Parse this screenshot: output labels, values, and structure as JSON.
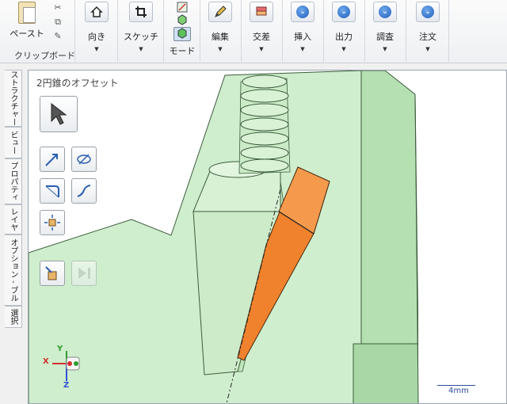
{
  "ribbon": {
    "paste_label": "ペースト",
    "clipboard_group_label": "クリップボード",
    "buttons": [
      {
        "label": "向き",
        "icon": "home-icon"
      },
      {
        "label": "スケッチ",
        "icon": "crop-sketch-icon"
      },
      {
        "label": "モード",
        "icon": "mode-solid-icon"
      },
      {
        "label": "編集",
        "icon": "pencil-edit-icon"
      },
      {
        "label": "交差",
        "icon": "intersect-icon"
      },
      {
        "label": "挿入",
        "icon": "circle-arrow-icon"
      },
      {
        "label": "出力",
        "icon": "circle-arrow-icon"
      },
      {
        "label": "調査",
        "icon": "circle-arrow-icon"
      },
      {
        "label": "注文",
        "icon": "circle-arrow-icon"
      }
    ]
  },
  "side_tabs": [
    "ストラクチャー",
    "ビュー",
    "プロパティ",
    "レイヤ",
    "オプション - ブル",
    "選択"
  ],
  "viewport": {
    "title": "2円錐のオフセット",
    "scale_label": "4mm",
    "axes": {
      "x": "X",
      "y": "Y",
      "z": "Z"
    }
  },
  "colors": {
    "model_green": "#c9eec7",
    "model_dark": "#9fd29c",
    "face_orange": "#f0822d",
    "axis_red": "#d23030",
    "axis_green": "#2f9c2f",
    "axis_blue": "#2f4fd8"
  }
}
